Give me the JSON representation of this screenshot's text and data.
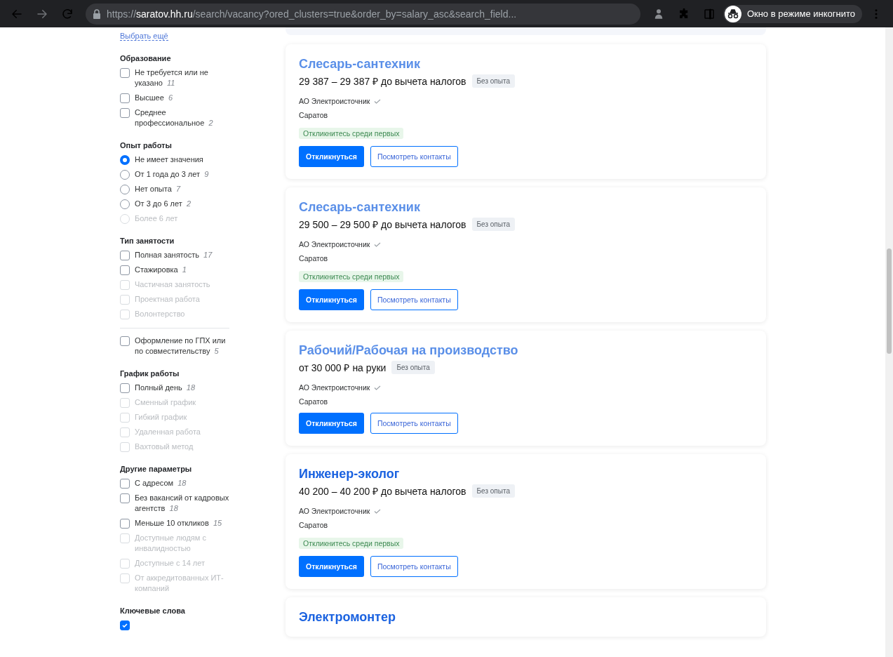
{
  "browser": {
    "url": {
      "scheme": "https://",
      "host": "saratov.hh.ru",
      "path": "/search/vacancy?ored_clusters=true&order_by=salary_asc&search_field..."
    },
    "profile_label": "Окно в режиме инкогнито"
  },
  "sidebar": {
    "more_link": "Выбрать ещё",
    "sections": [
      {
        "title": "Образование",
        "items": [
          {
            "kind": "checkbox",
            "label": "Не требуется или не указано",
            "count": "11",
            "checked": false,
            "disabled": false,
            "separated": false
          },
          {
            "kind": "checkbox",
            "label": "Высшее",
            "count": "6",
            "checked": false,
            "disabled": false,
            "separated": false
          },
          {
            "kind": "checkbox",
            "label": "Среднее профессиональное",
            "count": "2",
            "checked": false,
            "disabled": false,
            "separated": false
          }
        ]
      },
      {
        "title": "Опыт работы",
        "items": [
          {
            "kind": "radio",
            "label": "Не имеет значения",
            "checked": true,
            "disabled": false,
            "separated": false
          },
          {
            "kind": "radio",
            "label": "От 1 года до 3 лет",
            "count": "9",
            "checked": false,
            "disabled": false,
            "separated": false
          },
          {
            "kind": "radio",
            "label": "Нет опыта",
            "count": "7",
            "checked": false,
            "disabled": false,
            "separated": false
          },
          {
            "kind": "radio",
            "label": "От 3 до 6 лет",
            "count": "2",
            "checked": false,
            "disabled": false,
            "separated": false
          },
          {
            "kind": "radio",
            "label": "Более 6 лет",
            "checked": false,
            "disabled": true,
            "separated": false
          }
        ]
      },
      {
        "title": "Тип занятости",
        "items": [
          {
            "kind": "checkbox",
            "label": "Полная занятость",
            "count": "17",
            "checked": false,
            "disabled": false,
            "separated": false
          },
          {
            "kind": "checkbox",
            "label": "Стажировка",
            "count": "1",
            "checked": false,
            "disabled": false,
            "separated": false
          },
          {
            "kind": "checkbox",
            "label": "Частичная занятость",
            "checked": false,
            "disabled": true,
            "separated": false
          },
          {
            "kind": "checkbox",
            "label": "Проектная работа",
            "checked": false,
            "disabled": true,
            "separated": false
          },
          {
            "kind": "checkbox",
            "label": "Волонтерство",
            "checked": false,
            "disabled": true,
            "separated": false
          },
          {
            "kind": "checkbox",
            "label": "Оформление по ГПХ или по совместительству",
            "count": "5",
            "checked": false,
            "disabled": false,
            "separated": true
          }
        ]
      },
      {
        "title": "График работы",
        "items": [
          {
            "kind": "checkbox",
            "label": "Полный день",
            "count": "18",
            "checked": false,
            "disabled": false,
            "separated": false
          },
          {
            "kind": "checkbox",
            "label": "Сменный график",
            "checked": false,
            "disabled": true,
            "separated": false
          },
          {
            "kind": "checkbox",
            "label": "Гибкий график",
            "checked": false,
            "disabled": true,
            "separated": false
          },
          {
            "kind": "checkbox",
            "label": "Удаленная работа",
            "checked": false,
            "disabled": true,
            "separated": false
          },
          {
            "kind": "checkbox",
            "label": "Вахтовый метод",
            "checked": false,
            "disabled": true,
            "separated": false
          }
        ]
      },
      {
        "title": "Другие параметры",
        "items": [
          {
            "kind": "checkbox",
            "label": "С адресом",
            "count": "18",
            "checked": false,
            "disabled": false,
            "separated": false
          },
          {
            "kind": "checkbox",
            "label": "Без вакансий от кадровых агентств",
            "count": "18",
            "checked": false,
            "disabled": false,
            "separated": false
          },
          {
            "kind": "checkbox",
            "label": "Меньше 10 откликов",
            "count": "15",
            "checked": false,
            "disabled": false,
            "separated": false
          },
          {
            "kind": "checkbox",
            "label": "Доступные людям с инвалидностью",
            "checked": false,
            "disabled": true,
            "separated": false
          },
          {
            "kind": "checkbox",
            "label": "Доступные с 14 лет",
            "checked": false,
            "disabled": true,
            "separated": false
          },
          {
            "kind": "checkbox",
            "label": "От аккредитованных ИТ-компаний",
            "checked": false,
            "disabled": true,
            "separated": false
          }
        ]
      },
      {
        "title": "Ключевые слова",
        "items": [
          {
            "kind": "checkbox",
            "checked": true,
            "disabled": false
          }
        ]
      }
    ]
  },
  "vacancies": [
    {
      "title": "Слесарь-сантехник",
      "visited": true,
      "salary": "29 387 – 29 387 ₽ до вычета налогов",
      "experience": "Без опыта",
      "employer": "АО Электроисточник",
      "city": "Саратов",
      "promo": "Откликнитесь среди первых",
      "respond_button": "Откликнуться",
      "contacts_button": "Посмотреть контакты"
    },
    {
      "title": "Слесарь-сантехник",
      "visited": true,
      "salary": "29 500 – 29 500 ₽ до вычета налогов",
      "experience": "Без опыта",
      "employer": "АО Электроисточник",
      "city": "Саратов",
      "promo": "Откликнитесь среди первых",
      "respond_button": "Откликнуться",
      "contacts_button": "Посмотреть контакты"
    },
    {
      "title": "Рабочий/Рабочая на производство",
      "visited": true,
      "salary": "от 30 000 ₽ на руки",
      "experience": "Без опыта",
      "employer": "АО Электроисточник",
      "city": "Саратов",
      "respond_button": "Откликнуться",
      "contacts_button": "Посмотреть контакты"
    },
    {
      "title": "Инженер-эколог",
      "visited": false,
      "salary": "40 200 – 40 200 ₽ до вычета налогов",
      "experience": "Без опыта",
      "employer": "АО Электроисточник",
      "city": "Саратов",
      "promo": "Откликнитесь среди первых",
      "respond_button": "Откликнуться",
      "contacts_button": "Посмотреть контакты"
    },
    {
      "title": "Электромонтер",
      "visited": false
    }
  ]
}
